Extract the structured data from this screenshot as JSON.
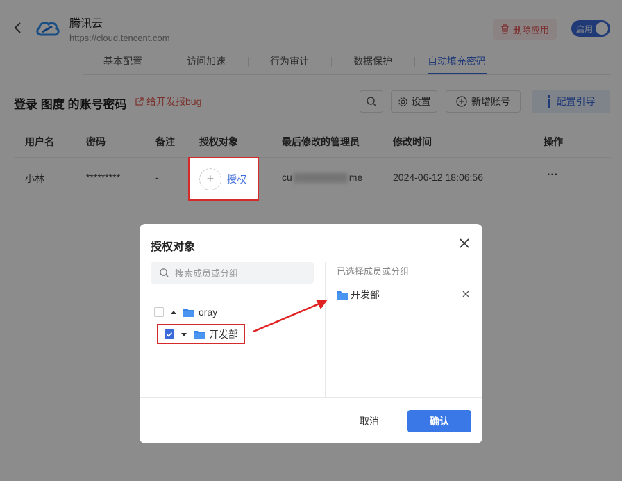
{
  "header": {
    "app_name": "腾讯云",
    "app_url": "https://cloud.tencent.com",
    "delete_label": "删除应用",
    "toggle_label": "启用"
  },
  "tabs": [
    {
      "label": "基本配置"
    },
    {
      "label": "访问加速"
    },
    {
      "label": "行为审计"
    },
    {
      "label": "数据保护"
    },
    {
      "label": "自动填充密码",
      "active": true
    }
  ],
  "section": {
    "title": "登录 图度 的账号密码",
    "bug_link": "给开发报bug",
    "settings_label": "设置",
    "add_account_label": "新增账号",
    "guide_label": "配置引导"
  },
  "table": {
    "headers": [
      "用户名",
      "密码",
      "备注",
      "授权对象",
      "最后修改的管理员",
      "修改时间",
      "操作"
    ],
    "rows": [
      {
        "username": "小林",
        "password": "*********",
        "note": "-",
        "auth": "授权",
        "admin_prefix": "cu",
        "admin_suffix": "me",
        "modified": "2024-06-12 18:06:56",
        "action": "···"
      }
    ]
  },
  "modal": {
    "title": "授权对象",
    "search_placeholder": "搜索成员或分组",
    "tree": [
      {
        "label": "oray",
        "checked": false
      },
      {
        "label": "开发部",
        "checked": true
      }
    ],
    "selected_header": "已选择成员或分组",
    "selected": [
      {
        "label": "开发部"
      }
    ],
    "cancel_label": "取消",
    "ok_label": "确认"
  },
  "colors": {
    "accent": "#3b6bd9",
    "danger": "#d62a2a"
  }
}
